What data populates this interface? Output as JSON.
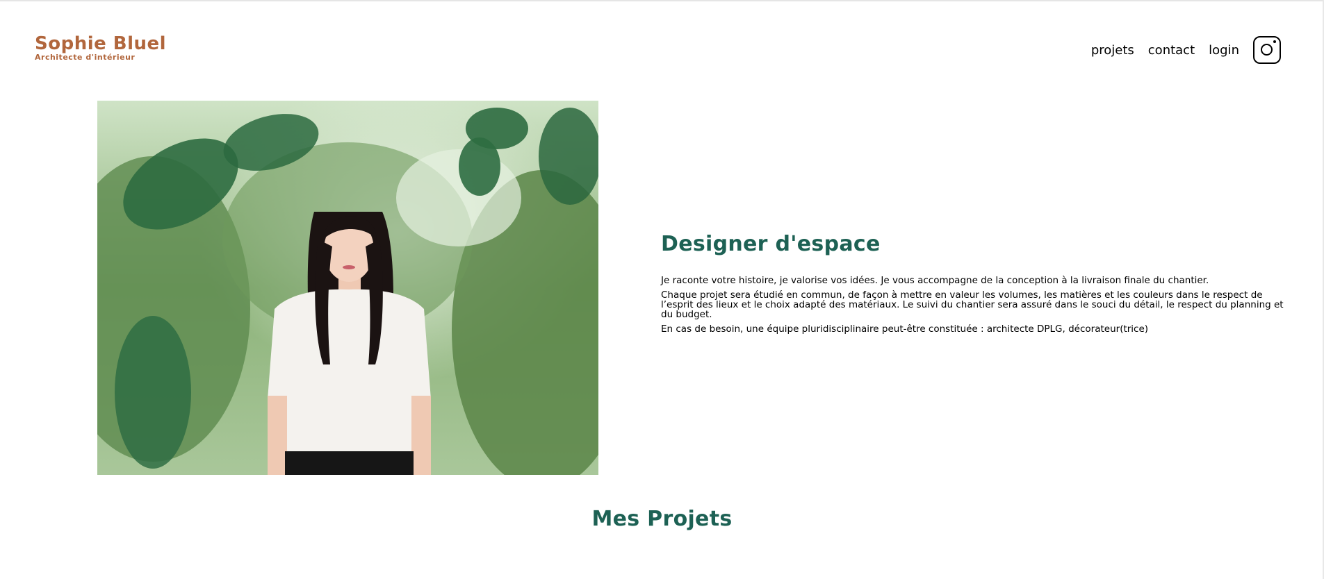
{
  "logo": {
    "title": "Sophie Bluel",
    "subtitle": "Architecte d'intérieur"
  },
  "nav": {
    "items": [
      {
        "label": "projets"
      },
      {
        "label": "contact"
      },
      {
        "label": "login"
      }
    ],
    "social_icon": "instagram-icon"
  },
  "hero": {
    "image_subject": "portrait photo",
    "title": "Designer d'espace",
    "paragraphs": [
      "Je raconte votre histoire, je valorise vos idées. Je vous accompagne de la conception à la livraison finale du chantier.",
      "Chaque projet sera étudié en commun, de façon à mettre en valeur les volumes, les matières et les couleurs dans le respect de l’esprit des lieux et le choix adapté des matériaux. Le suivi du chantier sera assuré dans le souci du détail, le respect du planning et du budget.",
      "En cas de besoin, une équipe pluridisciplinaire peut-être constituée : architecte DPLG, décorateur(trice)"
    ]
  },
  "projects": {
    "title": "Mes Projets"
  },
  "colors": {
    "brand": "#b1663c",
    "accent": "#1d6154"
  }
}
